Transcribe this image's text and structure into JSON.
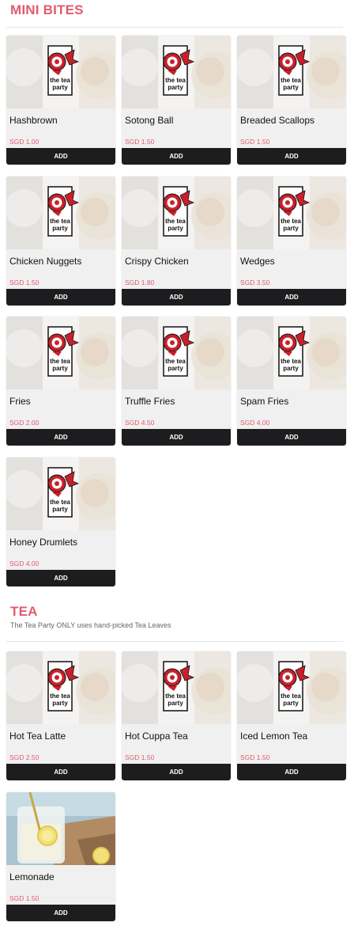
{
  "sections": [
    {
      "title": "MINI BITES",
      "subtitle": "",
      "items": [
        {
          "name": "Hashbrown",
          "price": "SGD 1.00",
          "add_label": "ADD",
          "image": "tea-party-logo"
        },
        {
          "name": "Sotong Ball",
          "price": "SGD 1.50",
          "add_label": "ADD",
          "image": "tea-party-logo"
        },
        {
          "name": "Breaded Scallops",
          "price": "SGD 1.50",
          "add_label": "ADD",
          "image": "tea-party-logo"
        },
        {
          "name": "Chicken Nuggets",
          "price": "SGD 1.50",
          "add_label": "ADD",
          "image": "tea-party-logo"
        },
        {
          "name": "Crispy Chicken",
          "price": "SGD 1.80",
          "add_label": "ADD",
          "image": "tea-party-logo"
        },
        {
          "name": "Wedges",
          "price": "SGD 3.50",
          "add_label": "ADD",
          "image": "tea-party-logo"
        },
        {
          "name": "Fries",
          "price": "SGD 2.00",
          "add_label": "ADD",
          "image": "tea-party-logo"
        },
        {
          "name": "Truffle Fries",
          "price": "SGD 4.50",
          "add_label": "ADD",
          "image": "tea-party-logo"
        },
        {
          "name": "Spam Fries",
          "price": "SGD 4.00",
          "add_label": "ADD",
          "image": "tea-party-logo"
        },
        {
          "name": "Honey Drumlets",
          "price": "SGD 4.00",
          "add_label": "ADD",
          "image": "tea-party-logo"
        }
      ]
    },
    {
      "title": "TEA",
      "subtitle": "The Tea Party ONLY uses hand-picked Tea Leaves",
      "items": [
        {
          "name": "Hot Tea Latte",
          "price": "SGD 2.50",
          "add_label": "ADD",
          "image": "tea-party-logo"
        },
        {
          "name": "Hot Cuppa Tea",
          "price": "SGD 1.50",
          "add_label": "ADD",
          "image": "tea-party-logo"
        },
        {
          "name": "Iced Lemon Tea",
          "price": "SGD 1.50",
          "add_label": "ADD",
          "image": "tea-party-logo"
        },
        {
          "name": "Lemonade",
          "price": "SGD 1.50",
          "add_label": "ADD",
          "image": "lemonade-photo"
        }
      ]
    }
  ],
  "logo_text": [
    "the tea",
    "party"
  ],
  "colors": {
    "accent": "#e05b6f",
    "button_bg": "#1d1d1f",
    "card_bg": "#f0f0f0",
    "logo_red": "#c8202a"
  }
}
